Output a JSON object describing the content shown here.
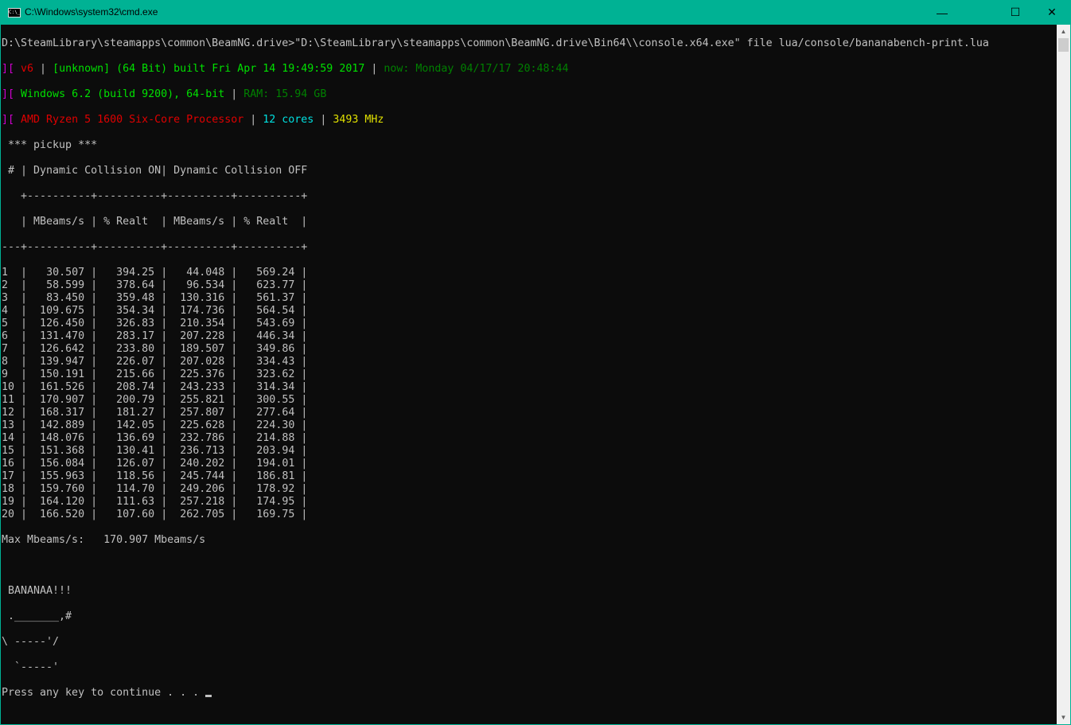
{
  "window": {
    "title": "C:\\Windows\\system32\\cmd.exe",
    "icon": "C:\\_",
    "minimize": "—",
    "maximize": "☐",
    "close": "✕"
  },
  "command": "D:\\SteamLibrary\\steamapps\\common\\BeamNG.drive>\"D:\\SteamLibrary\\steamapps\\common\\BeamNG.drive\\Bin64\\\\console.x64.exe\" file lua/console/bananabench-print.lua",
  "info": {
    "prefix": "][ ",
    "sep": " | ",
    "version": "v6",
    "build": "[unknown] (64 Bit) built Fri Apr 14 19:49:59 2017",
    "now": "now: Monday 04/17/17 20:48:44",
    "os": "Windows 6.2 (build 9200), 64-bit",
    "ram": "RAM: 15.94 GB",
    "cpu": "AMD Ryzen 5 1600 Six-Core Processor",
    "cores": "12 cores",
    "mhz": "3493 MHz"
  },
  "table": {
    "title": " *** pickup ***",
    "group_header": " # | Dynamic Collision ON| Dynamic Collision OFF",
    "divider1": "   +----------+----------+----------+----------+",
    "col_header": "   | MBeams/s | % Realt  | MBeams/s | % Realt  |",
    "divider2": "---+----------+----------+----------+----------+",
    "rows": [
      [
        "1",
        "30.507",
        "394.25",
        "44.048",
        "569.24"
      ],
      [
        "2",
        "58.599",
        "378.64",
        "96.534",
        "623.77"
      ],
      [
        "3",
        "83.450",
        "359.48",
        "130.316",
        "561.37"
      ],
      [
        "4",
        "109.675",
        "354.34",
        "174.736",
        "564.54"
      ],
      [
        "5",
        "126.450",
        "326.83",
        "210.354",
        "543.69"
      ],
      [
        "6",
        "131.470",
        "283.17",
        "207.228",
        "446.34"
      ],
      [
        "7",
        "126.642",
        "233.80",
        "189.507",
        "349.86"
      ],
      [
        "8",
        "139.947",
        "226.07",
        "207.028",
        "334.43"
      ],
      [
        "9",
        "150.191",
        "215.66",
        "225.376",
        "323.62"
      ],
      [
        "10",
        "161.526",
        "208.74",
        "243.233",
        "314.34"
      ],
      [
        "11",
        "170.907",
        "200.79",
        "255.821",
        "300.55"
      ],
      [
        "12",
        "168.317",
        "181.27",
        "257.807",
        "277.64"
      ],
      [
        "13",
        "142.889",
        "142.05",
        "225.628",
        "224.30"
      ],
      [
        "14",
        "148.076",
        "136.69",
        "232.786",
        "214.88"
      ],
      [
        "15",
        "151.368",
        "130.41",
        "236.713",
        "203.94"
      ],
      [
        "16",
        "156.084",
        "126.07",
        "240.202",
        "194.01"
      ],
      [
        "17",
        "155.963",
        "118.56",
        "245.744",
        "186.81"
      ],
      [
        "18",
        "159.760",
        "114.70",
        "249.206",
        "178.92"
      ],
      [
        "19",
        "164.120",
        "111.63",
        "257.218",
        "174.95"
      ],
      [
        "20",
        "166.520",
        "107.60",
        "262.705",
        "169.75"
      ]
    ],
    "max_line": "Max Mbeams/s:   170.907 Mbeams/s"
  },
  "banana": [
    " BANANAA!!!",
    " ._______,#",
    "\\ -----'/",
    "  `-----'"
  ],
  "prompt": "Press any key to continue . . . "
}
